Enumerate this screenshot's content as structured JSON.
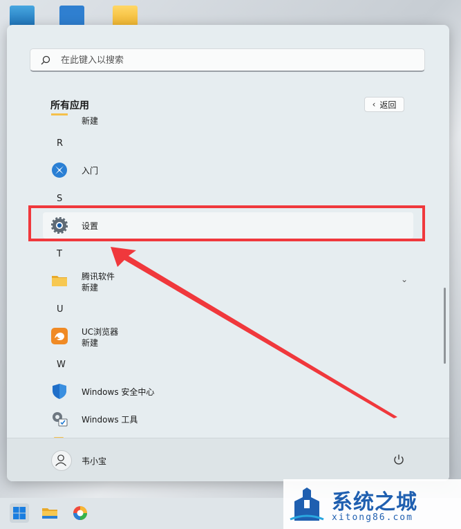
{
  "search": {
    "placeholder": "在此键入以搜索"
  },
  "all_apps": {
    "title": "所有应用",
    "back_label": "返回"
  },
  "apps": {
    "partial_top_sub": "新建",
    "letter_r": "R",
    "get_started": "入门",
    "letter_s": "S",
    "settings": "设置",
    "letter_t": "T",
    "tencent_name": "腾讯软件",
    "tencent_sub": "新建",
    "letter_u": "U",
    "uc_name": "UC浏览器",
    "uc_sub": "新建",
    "letter_w": "W",
    "security_name": "Windows 安全中心",
    "tools_name": "Windows 工具"
  },
  "footer": {
    "username": "韦小宝"
  },
  "watermark": {
    "title": "系统之城",
    "url": "xitong86.com"
  },
  "colors": {
    "highlight": "#f0383c",
    "accent": "#0067c0",
    "folder": "#f5c04a"
  },
  "icons": [
    "search-icon",
    "chevron-left-icon",
    "get-started-icon",
    "settings-gear-icon",
    "folder-icon",
    "chevron-down-icon",
    "uc-browser-icon",
    "shield-icon",
    "tools-icon",
    "user-avatar-icon",
    "power-icon",
    "windows-logo-icon",
    "file-explorer-icon",
    "browser-icon"
  ]
}
